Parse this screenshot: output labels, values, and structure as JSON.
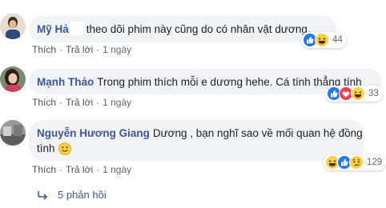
{
  "comments": [
    {
      "name": "Mỹ Hả",
      "text": "theo dõi phim này cũng do có nhân vật dương.",
      "like": "Thích",
      "reply": "Trả lời",
      "time": "1 ngày",
      "reaction_icons": [
        "like-icon",
        "haha-icon"
      ],
      "reaction_count": "44"
    },
    {
      "name": "Mạnh Thảo",
      "text": "Trong phim thích mỗi e dương hehe. Cá tính thẳng tính",
      "like": "Thích",
      "reply": "Trả lời",
      "time": "1 ngày",
      "reaction_icons": [
        "like-icon",
        "love-icon",
        "haha-icon"
      ],
      "reaction_count": "33"
    },
    {
      "name": "Nguyễn Hương Giang",
      "text_line1": "Dương , bạn nghĩ sao về mối quan hệ đồng",
      "text_line2": "tình",
      "like": "Thích",
      "reply": "Trả lời",
      "time": "1 ngày",
      "reaction_icons": [
        "haha-icon",
        "like-icon",
        "sad-icon"
      ],
      "reaction_count": "129"
    }
  ],
  "replies_label": "5 phản hồi",
  "colors": {
    "name": "#385898",
    "bubble": "#f2f3f5",
    "like_blue": "#2078f4",
    "love_red": "#f33e58",
    "haha_yellow": "#fcd043"
  }
}
